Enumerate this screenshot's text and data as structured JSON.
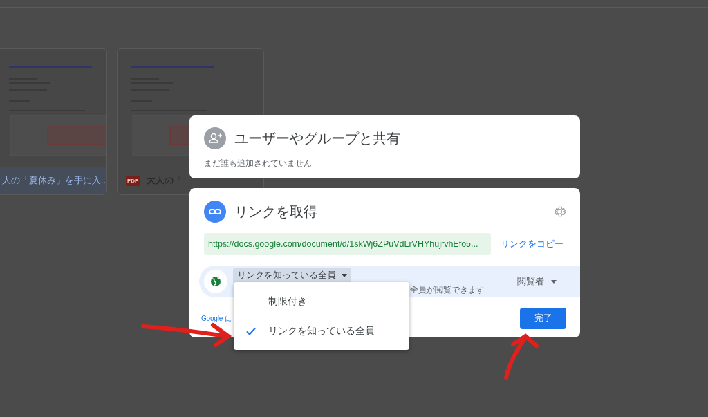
{
  "background": {
    "files": [
      {
        "title": "人の「夏休み」を手に入...",
        "selected": true,
        "kind": "doc"
      },
      {
        "title": "大人の「",
        "selected": false,
        "kind": "pdf",
        "badge": "PDF"
      }
    ]
  },
  "share_dialog": {
    "title": "ユーザーやグループと共有",
    "subtitle": "まだ誰も追加されていません"
  },
  "link_dialog": {
    "title": "リンクを取得",
    "url": "https://docs.google.com/document/d/1skWj6ZPuVdLrVHYhujrvhEfo5...",
    "copy_link": "リンクをコピー",
    "access": {
      "scope": "リンクを知っている全員",
      "description": "全員が閲覧できます",
      "role": "閲覧者"
    },
    "footer_link": "Google に",
    "done_button": "完了"
  },
  "scope_menu": [
    {
      "label": "制限付き",
      "selected": false
    },
    {
      "label": "リンクを知っている全員",
      "selected": true
    }
  ]
}
